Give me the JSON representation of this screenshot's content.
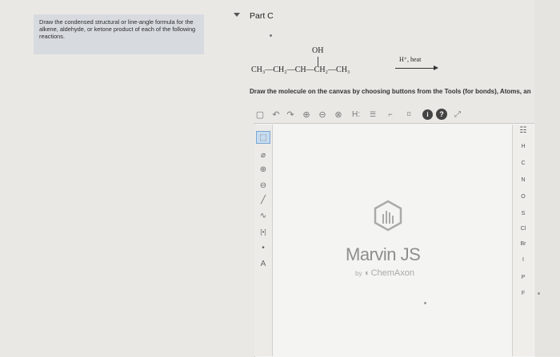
{
  "instructions": {
    "text": "Draw the condensed structural or line-angle formula for the alkene, aldehyde, or ketone product of each of the following reactions."
  },
  "part": {
    "label": "Part C"
  },
  "reaction": {
    "substituent": "OH",
    "chain": "CH₃—CH₂—CH—CH₂—CH₃",
    "conditions": "H⁺, heat"
  },
  "prompt": "Draw the molecule on the canvas by choosing buttons from the Tools (for bonds), Atoms, an",
  "toolbar": {
    "items": [
      {
        "name": "new-doc-icon",
        "glyph": "▢"
      },
      {
        "name": "undo-icon",
        "glyph": "↶"
      },
      {
        "name": "redo-icon",
        "glyph": "↷"
      },
      {
        "name": "zoom-in-icon",
        "glyph": "⊕"
      },
      {
        "name": "zoom-out-icon",
        "glyph": "⊖"
      },
      {
        "name": "zoom-fit-icon",
        "glyph": "⊗"
      },
      {
        "name": "explicit-h-icon",
        "glyph": "H:"
      },
      {
        "name": "template-icon",
        "glyph": "☰"
      },
      {
        "name": "expand-icon",
        "glyph": "⌐"
      },
      {
        "name": "contract-icon",
        "glyph": "⌑"
      }
    ],
    "info": "i",
    "help": "?"
  },
  "left_tools": [
    {
      "name": "select-tool-icon",
      "glyph": "⬚"
    },
    {
      "name": "erase-tool-icon",
      "glyph": "⌀"
    },
    {
      "name": "positive-charge-icon",
      "glyph": "⊕"
    },
    {
      "name": "negative-charge-icon",
      "glyph": "⊖"
    },
    {
      "name": "single-bond-icon",
      "glyph": "╱"
    },
    {
      "name": "chain-tool-icon",
      "glyph": "∿"
    },
    {
      "name": "bracket-tool-icon",
      "glyph": "[•]"
    },
    {
      "name": "radical-dot-icon",
      "glyph": "•"
    },
    {
      "name": "atom-property-icon",
      "glyph": "A"
    }
  ],
  "right_tools": {
    "periodic_table": "☷",
    "atoms": [
      "H",
      "C",
      "N",
      "O",
      "S",
      "Cl",
      "Br",
      "I",
      "P",
      "F"
    ]
  },
  "logo": {
    "brand": "Marvin JS",
    "by": "by",
    "company": "ChemAxon"
  },
  "colors": {
    "instruction_bg": "#d7dbe0",
    "canvas_bg": "#f4f4f2",
    "selected_tool": "#c6dcf0"
  }
}
